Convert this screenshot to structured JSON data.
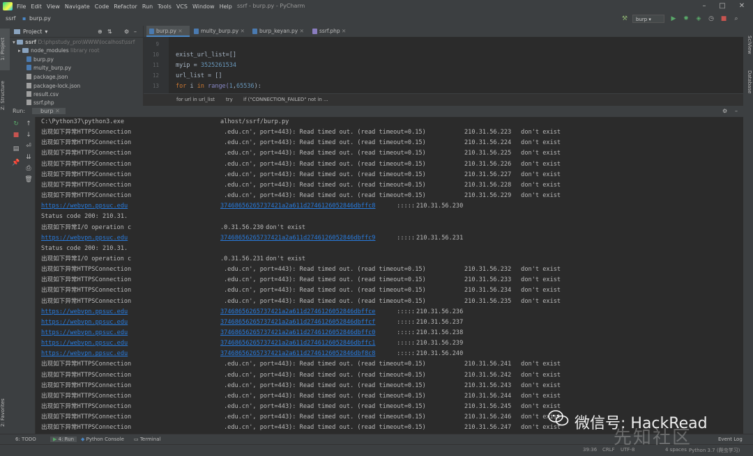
{
  "menubar": {
    "items": [
      "File",
      "Edit",
      "View",
      "Navigate",
      "Code",
      "Refactor",
      "Run",
      "Tools",
      "VCS",
      "Window",
      "Help"
    ],
    "title": "ssrf - burp.py - PyCharm"
  },
  "navbar": {
    "crumb1": "ssrf",
    "crumb2": "burp.py",
    "run_config": "burp"
  },
  "left_stripe": {
    "project": "1: Project",
    "structure": "Z: Structure",
    "favorites": "2: Favorites"
  },
  "right_stripe": {
    "sciview": "SciView",
    "database": "Database"
  },
  "project": {
    "header": "Project",
    "root": "ssrf",
    "root_path": "D:\\phpstudy_pro\\WWW\\localhost\\ssrf",
    "node_modules": "node_modules",
    "node_modules_hint": "library root",
    "files": [
      "burp.py",
      "multy_burp.py",
      "package.json",
      "package-lock.json",
      "result.csv",
      "ssrf.php"
    ]
  },
  "editor": {
    "tabs": [
      "burp.py",
      "multy_burp.py",
      "burp_keyan.py",
      "ssrf.php"
    ],
    "line_numbers": [
      "9",
      "10",
      "11",
      "12",
      "13"
    ],
    "lines": [
      {
        "a": "exist_url_list",
        "b": "=[]"
      },
      {
        "a": "myip = ",
        "b": "3525261534"
      },
      {
        "a": "url_list = []",
        "b": ""
      },
      {
        "a": "for",
        "b": " i ",
        "c": "in",
        "d": " range(",
        "e": "1",
        "f": ",",
        "g": "65536",
        "h": "):"
      }
    ],
    "breadcrumbs": [
      "for url in url_list",
      "try",
      "if (\"CONNECTION_FAILED\" not in ..."
    ]
  },
  "run": {
    "label": "Run:",
    "config": "burp",
    "first_line": {
      "left": "C:\\Python37\\python3.exe",
      "right": "alhost/ssrf/burp.py"
    },
    "lines": [
      {
        "t": "err",
        "ip": "210.31.56.223"
      },
      {
        "t": "err",
        "ip": "210.31.56.224"
      },
      {
        "t": "err",
        "ip": "210.31.56.225"
      },
      {
        "t": "err",
        "ip": "210.31.56.226"
      },
      {
        "t": "err",
        "ip": "210.31.56.227"
      },
      {
        "t": "err",
        "ip": "210.31.56.228"
      },
      {
        "t": "err",
        "ip": "210.31.56.229"
      },
      {
        "t": "url",
        "hash": "37468656265737421a2a611d2746126052846dbffc8",
        "ip": "210.31.56.230"
      },
      {
        "t": "status",
        "text": "Status code 200: 210.31."
      },
      {
        "t": "io",
        "ip": ".0.31.56.230"
      },
      {
        "t": "url",
        "hash": "37468656265737421a2a611d2746126052846dbffc9",
        "ip": "210.31.56.231"
      },
      {
        "t": "status",
        "text": "Status code 200: 210.31."
      },
      {
        "t": "io",
        "ip": ".0.31.56.231"
      },
      {
        "t": "err",
        "ip": "210.31.56.232"
      },
      {
        "t": "err",
        "ip": "210.31.56.233"
      },
      {
        "t": "err",
        "ip": "210.31.56.234"
      },
      {
        "t": "err",
        "ip": "210.31.56.235"
      },
      {
        "t": "url",
        "hash": "37468656265737421a2a611d2746126052846dbffce",
        "ip": "210.31.56.236"
      },
      {
        "t": "url",
        "hash": "37468656265737421a2a611d2746126052846dbffcf",
        "ip": "210.31.56.237"
      },
      {
        "t": "url",
        "hash": "37468656265737421a2a611d2746126052846dbffc0",
        "ip": "210.31.56.238"
      },
      {
        "t": "url",
        "hash": "37468656265737421a2a611d2746126052846dbffc1",
        "ip": "210.31.56.239"
      },
      {
        "t": "url",
        "hash": "37468656265737421a2a611d2746126052846dbf8c8",
        "ip": "210.31.56.240"
      },
      {
        "t": "err",
        "ip": "210.31.56.241"
      },
      {
        "t": "err",
        "ip": "210.31.56.242"
      },
      {
        "t": "err",
        "ip": "210.31.56.243"
      },
      {
        "t": "err",
        "ip": "210.31.56.244"
      },
      {
        "t": "err",
        "ip": "210.31.56.245"
      },
      {
        "t": "err",
        "ip": "210.31.56.246"
      },
      {
        "t": "err",
        "ip": "210.31.56.247"
      }
    ],
    "err_prefix": "出现如下异常HTTPSConnection",
    "err_mid": ".edu.cn', port=443): Read timed out. (read timeout=0.15)",
    "not_exist": " don't exist",
    "io_prefix": "出现如下异常I/O operation c",
    "url_prefix": "https://webvpn.ppsuc.edu",
    "url_sep": " :::::"
  },
  "bottom_tabs": [
    "6: TODO",
    "4: Run",
    "Python Console",
    "Terminal"
  ],
  "status": {
    "position": "39:36",
    "line_sep": "CRLF",
    "encoding": "UTF-8",
    "indent": "4 spaces",
    "interpreter": "Python 3.7 (爬虫学习)",
    "event_log": "Event Log"
  },
  "watermark": {
    "text": "微信号: HackRead",
    "site": "先知社区"
  },
  "colors": {
    "accent": "#4a88c7",
    "link": "#287bde",
    "bg": "#2b2b2b",
    "panel": "#3c3f41"
  }
}
